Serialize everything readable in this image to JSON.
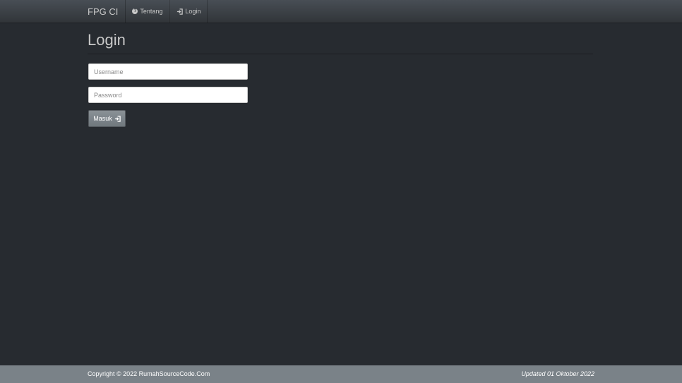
{
  "navbar": {
    "brand": "FPG CI",
    "items": [
      {
        "label": "Tentang",
        "icon": "question-circle-icon"
      },
      {
        "label": "Login",
        "icon": "sign-in-icon"
      }
    ]
  },
  "page": {
    "title": "Login"
  },
  "form": {
    "username": {
      "placeholder": "Username",
      "value": ""
    },
    "password": {
      "placeholder": "Password",
      "value": ""
    },
    "submit_label": "Masuk",
    "submit_icon": "sign-in-icon"
  },
  "footer": {
    "copyright": "Copyright © 2022 RumahSourceCode.Com",
    "updated": "Updated 01 Oktober 2022"
  },
  "colors": {
    "background": "#272b30",
    "navbar": "#3a3f44",
    "footer": "#7a8288",
    "button": "#7a8288"
  }
}
